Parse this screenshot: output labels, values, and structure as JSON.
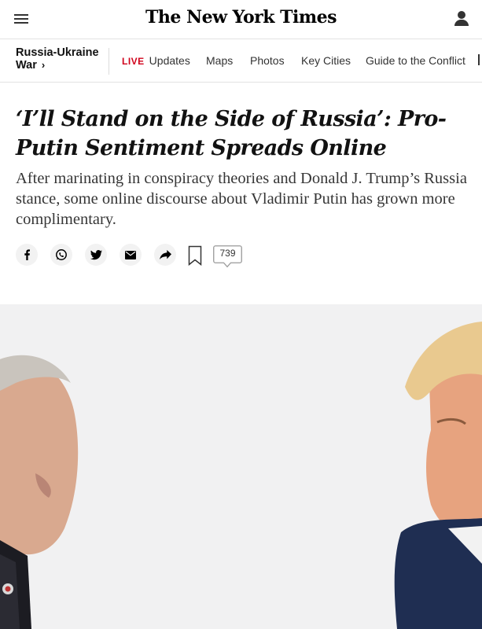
{
  "header": {
    "logo": "The New York Times",
    "menu_icon": "hamburger-menu-icon",
    "account_icon": "account-icon"
  },
  "section_nav": {
    "title_line1": "Russia-Ukraine",
    "title_line2": "War",
    "title_chevron": "›",
    "live_tag": "LIVE",
    "links": [
      "Updates",
      "Maps",
      "Photos",
      "Key Cities",
      "Guide to the Conflict"
    ]
  },
  "article": {
    "headline": "‘I’ll Stand on the Side of Russia’: Pro-Putin Sentiment Spreads Online",
    "summary": "After marinating in conspiracy theories and Donald J. Trump’s Russia stance, some online discourse about Vladimir Putin has grown more complimentary."
  },
  "share_tools": {
    "icons": [
      "facebook-icon",
      "whatsapp-icon",
      "twitter-icon",
      "email-icon",
      "share-arrow-icon",
      "bookmark-icon"
    ],
    "comment_count": "739"
  },
  "colors": {
    "live_red": "#d0021b",
    "text": "#121212",
    "summary_text": "#363636",
    "photo_background": "#f1f1f2"
  }
}
